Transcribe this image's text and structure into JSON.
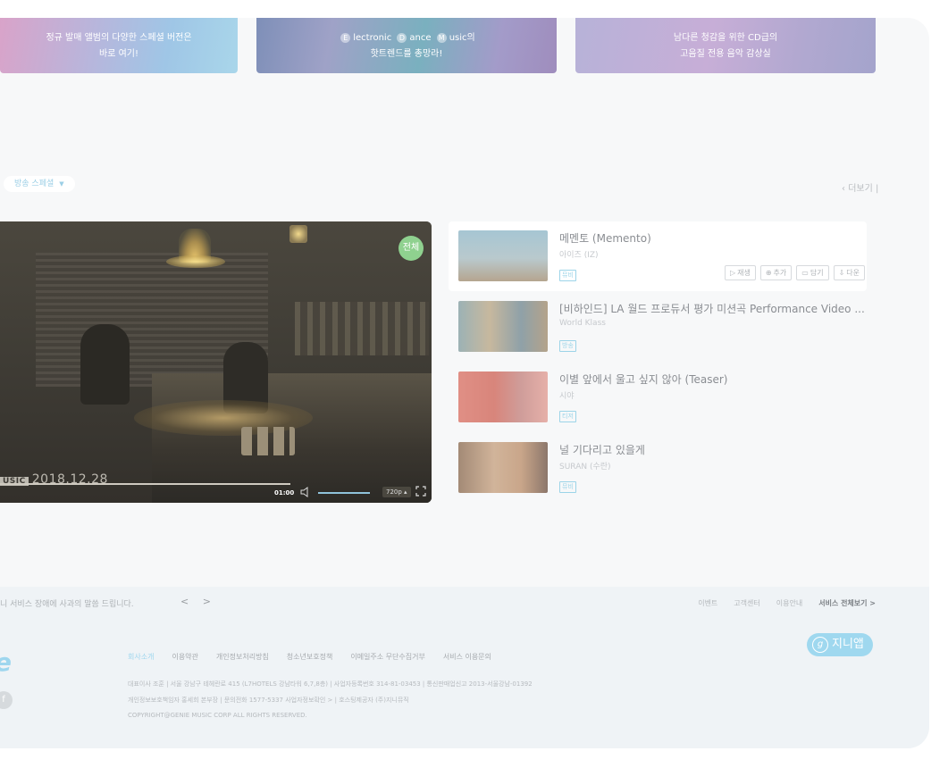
{
  "banners": [
    {
      "line1": "정규 발매 앨범의 다양한 스페셜 버전은",
      "line2": "바로 여기!"
    },
    {
      "line1_parts": [
        "E",
        "lectronic",
        "D",
        "ance",
        "M",
        "usic의"
      ],
      "line2": "핫트렌드를 총망라!"
    },
    {
      "line1": "남다른 청감을 위한 CD급의",
      "line2": "고음질 전용 음악 감상실"
    }
  ],
  "section": {
    "dropdown_label": "방송 스페셜",
    "more_label": "더보기"
  },
  "player": {
    "age_badge": "전체",
    "watermark_tag": "USIC",
    "watermark_date": "2018.12.28",
    "time": "01:00",
    "quality": "720p"
  },
  "videos": [
    {
      "title": "메멘토 (Memento)",
      "artist": "아이즈 (IZ)",
      "tag": "뮤비"
    },
    {
      "title": "[비하인드] LA 월드 프로듀서 평가 미션곡 Performance Video ...",
      "artist": "World Klass",
      "tag": "방송"
    },
    {
      "title": "이별 앞에서 울고 싶지 않아 (Teaser)",
      "artist": "시야",
      "tag": "티저"
    },
    {
      "title": "널 기다리고 있을게",
      "artist": "SURAN (수란)",
      "tag": "뮤비"
    }
  ],
  "actions": {
    "play": "재생",
    "add": "추가",
    "save": "담기",
    "download": "다운"
  },
  "footer": {
    "notice": "니 서비스 장애에 사과의 말씀 드립니다.",
    "pager": "< >",
    "links": [
      "이벤트",
      "고객센터",
      "이용안내"
    ],
    "all_services": "서비스 전체보기 >",
    "logo_fragment": "e",
    "facebook": "f",
    "app_badge": "지니앱",
    "app_letter": "g",
    "menu": [
      "회사소개",
      "이용약관",
      "개인정보처리방침",
      "청소년보호정책",
      "이메일주소 무단수집거부",
      "서비스 이용문의"
    ],
    "info1": "대표이사 조훈 | 서울 강남구 테헤란로 415 (L7HOTELS 강남타워 6,7,8층) | 사업자등록번호 314-81-03453 | 통신판매업신고 2013-서울강남-01392",
    "info2": "개인정보보호책임자 홍세희 본부장 | 문의전화 1577-5337 사업자정보확인 > | 호스팅제공자 (주)지니뮤직",
    "info3": "COPYRIGHT@GENIE MUSIC CORP ALL RIGHTS RESERVED."
  }
}
